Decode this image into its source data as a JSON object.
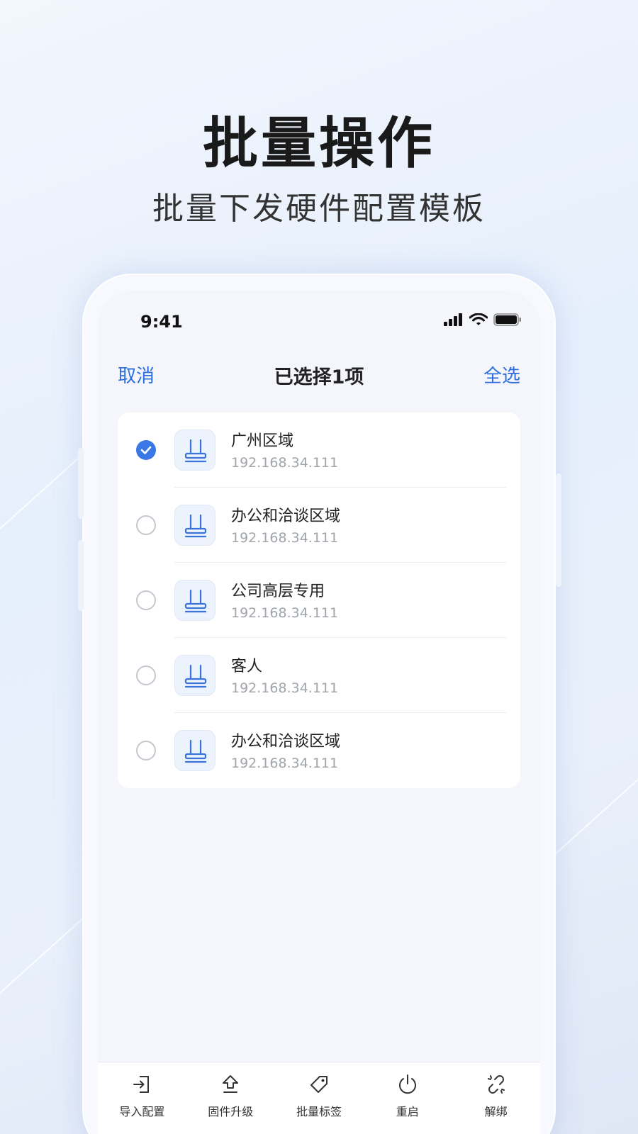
{
  "hero": {
    "title": "批量操作",
    "subtitle": "批量下发硬件配置模板"
  },
  "status_bar": {
    "time": "9:41"
  },
  "nav": {
    "cancel_label": "取消",
    "title": "已选择1项",
    "select_all_label": "全选"
  },
  "devices": [
    {
      "name": "广州区域",
      "ip": "192.168.34.111",
      "checked": true
    },
    {
      "name": "办公和洽谈区域",
      "ip": "192.168.34.111",
      "checked": false
    },
    {
      "name": "公司高层专用",
      "ip": "192.168.34.111",
      "checked": false
    },
    {
      "name": "客人",
      "ip": "192.168.34.111",
      "checked": false
    },
    {
      "name": "办公和洽谈区域",
      "ip": "192.168.34.111",
      "checked": false
    }
  ],
  "toolbar": [
    {
      "label": "导入配置",
      "icon": "import-icon"
    },
    {
      "label": "固件升级",
      "icon": "upgrade-icon"
    },
    {
      "label": "批量标签",
      "icon": "tag-icon"
    },
    {
      "label": "重启",
      "icon": "power-icon"
    },
    {
      "label": "解绑",
      "icon": "unlink-icon"
    }
  ],
  "colors": {
    "accent": "#2c6ee0",
    "checked": "#3a78e6",
    "icon_stroke": "#3b74d9"
  }
}
